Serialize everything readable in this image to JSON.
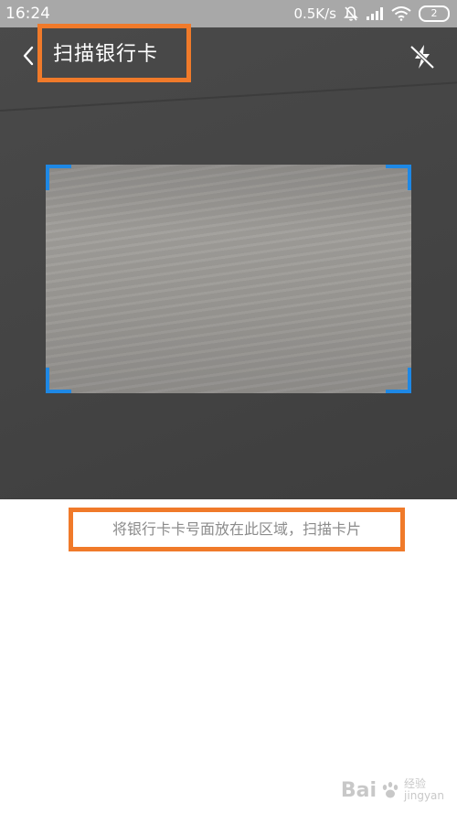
{
  "status_bar": {
    "time": "16:24",
    "net_speed": "0.5K/s",
    "battery_level": "2",
    "icons": [
      "mute-icon",
      "signal-icon",
      "wifi-icon",
      "battery-icon"
    ]
  },
  "header": {
    "back_icon": "chevron-left-icon",
    "title": "扫描银行卡",
    "flash_icon": "flash-off-icon"
  },
  "scanner": {
    "hint": "将银行卡卡号面放在此区域，扫描卡片",
    "frame_color": "#1e88e5"
  },
  "annotations": {
    "highlight_color": "#f07a2a"
  },
  "watermark": {
    "brand": "Bai",
    "sub_top": "经验",
    "sub_bottom": "jingyan"
  }
}
